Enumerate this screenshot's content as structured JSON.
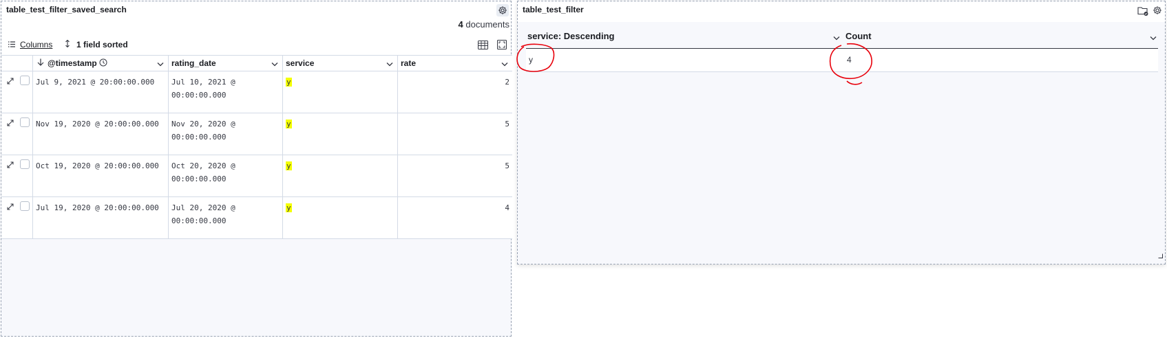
{
  "left_panel": {
    "title": "table_test_filter_saved_search",
    "doc_count": "4",
    "doc_label": "documents",
    "toolbar": {
      "columns_label": "Columns",
      "sort_label": "1 field sorted"
    },
    "columns": [
      "@timestamp",
      "rating_date",
      "service",
      "rate"
    ],
    "rows": [
      {
        "timestamp": "Jul 9, 2021 @ 20:00:00.000",
        "rating_date_l1": "Jul 10, 2021 @",
        "rating_date_l2": "00:00:00.000",
        "service": "y",
        "rate": "2"
      },
      {
        "timestamp": "Nov 19, 2020 @ 20:00:00.000",
        "rating_date_l1": "Nov 20, 2020 @",
        "rating_date_l2": "00:00:00.000",
        "service": "y",
        "rate": "5"
      },
      {
        "timestamp": "Oct 19, 2020 @ 20:00:00.000",
        "rating_date_l1": "Oct 20, 2020 @",
        "rating_date_l2": "00:00:00.000",
        "service": "y",
        "rate": "5"
      },
      {
        "timestamp": "Jul 19, 2020 @ 20:00:00.000",
        "rating_date_l1": "Jul 20, 2020 @",
        "rating_date_l2": "00:00:00.000",
        "service": "y",
        "rate": "4"
      }
    ]
  },
  "right_panel": {
    "title": "table_test_filter",
    "columns": [
      "service: Descending",
      "Count"
    ],
    "rows": [
      {
        "service": "y",
        "count": "4"
      }
    ]
  },
  "colors": {
    "highlight": "#f4ff00",
    "annotation": "#e8000b",
    "border": "#d3dae6"
  },
  "icons": [
    "gear-icon",
    "list-icon",
    "sort-icon",
    "table-density-icon",
    "fullscreen-icon",
    "arrow-down-icon",
    "clock-icon",
    "chevron-down-icon",
    "expand-icon",
    "folder-check-icon",
    "resize-handle-icon"
  ]
}
